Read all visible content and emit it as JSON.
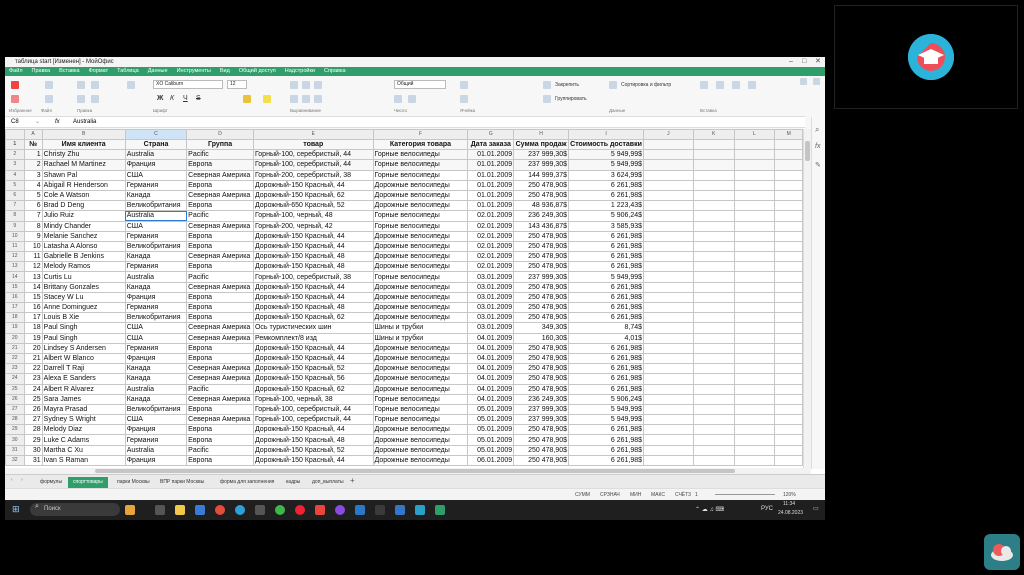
{
  "window": {
    "title": "таблица start [Изменен] - МойОфис"
  },
  "menu": [
    "Файл",
    "Правка",
    "Вставка",
    "Формат",
    "Таблица",
    "Данные",
    "Инструменты",
    "Вид",
    "Общий доступ",
    "Надстройки",
    "Справка"
  ],
  "ribbon": {
    "font": "XO Caliburn",
    "size": "12",
    "numformat": "Общий",
    "b": "Ж",
    "i": "К",
    "u": "Ч",
    "s": "S",
    "merge": "Закрепить",
    "group": "Группировать",
    "sort": "Сортировка и фильтр",
    "groups": {
      "favorites": "Избранное",
      "file": "Файл",
      "edit": "Правка",
      "font": "Шрифт",
      "align": "Выравнивание",
      "number": "Число",
      "cells": "Ячейка",
      "data": "Данные",
      "insert": "Вставка"
    }
  },
  "formula": {
    "cell": "C8",
    "fx": "fx",
    "value": "Australia"
  },
  "columns": [
    "",
    "A",
    "B",
    "C",
    "D",
    "E",
    "F",
    "G",
    "H",
    "I",
    "J",
    "K",
    "L",
    "M"
  ],
  "rows": [
    [
      "1",
      "№",
      "Имя клиента",
      "Страна",
      "Группа",
      "товар",
      "Категория товара",
      "Дата заказа",
      "Сумма продаж",
      "Стоимость доставки"
    ],
    [
      "2",
      "1",
      "Christy  Zhu",
      "Australia",
      "Pacific",
      "Горный-100, серебристый, 44",
      "Горные велосипеды",
      "01.01.2009",
      "237 999,30$",
      "5 949,99$"
    ],
    [
      "3",
      "2",
      "Rachael M Martinez",
      "Франция",
      "Европа",
      "Горный-100, серебристый, 44",
      "Горные велосипеды",
      "01.01.2009",
      "237 999,30$",
      "5 949,99$"
    ],
    [
      "4",
      "3",
      "Shawn  Pal",
      "США",
      "Северная Америка",
      "Горный-200, серебристый, 38",
      "Горные велосипеды",
      "01.01.2009",
      "144 999,37$",
      "3 624,99$"
    ],
    [
      "5",
      "4",
      "Abigail R Henderson",
      "Германия",
      "Европа",
      "Дорожный-150 Красный, 44",
      "Дорожные велосипеды",
      "01.01.2009",
      "250 478,90$",
      "6 261,98$"
    ],
    [
      "6",
      "5",
      "Cole A Watson",
      "Канада",
      "Северная Америка",
      "Дорожный-150 Красный, 62",
      "Дорожные велосипеды",
      "01.01.2009",
      "250 478,90$",
      "6 261,98$"
    ],
    [
      "7",
      "6",
      "Brad D Deng",
      "Великобритания",
      "Европа",
      "Дорожный-650 Красный, 52",
      "Дорожные велосипеды",
      "01.01.2009",
      "48 936,87$",
      "1 223,43$"
    ],
    [
      "8",
      "7",
      "Julio  Ruiz",
      "Australia",
      "Pacific",
      "Горный-100, черный, 48",
      "Горные велосипеды",
      "02.01.2009",
      "236 249,30$",
      "5 906,24$"
    ],
    [
      "9",
      "8",
      "Mindy  Chander",
      "США",
      "Северная Америка",
      "Горный-200, черный, 42",
      "Горные велосипеды",
      "02.01.2009",
      "143 436,87$",
      "3 585,93$"
    ],
    [
      "10",
      "9",
      "Melanie  Sanchez",
      "Германия",
      "Европа",
      "Дорожный-150 Красный, 44",
      "Дорожные велосипеды",
      "02.01.2009",
      "250 478,90$",
      "6 261,98$"
    ],
    [
      "11",
      "10",
      "Latasha A Alonso",
      "Великобритания",
      "Европа",
      "Дорожный-150 Красный, 44",
      "Дорожные велосипеды",
      "02.01.2009",
      "250 478,90$",
      "6 261,98$"
    ],
    [
      "12",
      "11",
      "Gabrielle B Jenkins",
      "Канада",
      "Северная Америка",
      "Дорожный-150 Красный, 48",
      "Дорожные велосипеды",
      "02.01.2009",
      "250 478,90$",
      "6 261,98$"
    ],
    [
      "13",
      "12",
      "Melody  Ramos",
      "Германия",
      "Европа",
      "Дорожный-150 Красный, 48",
      "Дорожные велосипеды",
      "02.01.2009",
      "250 478,90$",
      "6 261,98$"
    ],
    [
      "14",
      "13",
      "Curtis  Lu",
      "Australia",
      "Pacific",
      "Горный-100, серебристый, 38",
      "Горные велосипеды",
      "03.01.2009",
      "237 999,30$",
      "5 949,99$"
    ],
    [
      "15",
      "14",
      "Brittany  Gonzales",
      "Канада",
      "Северная Америка",
      "Дорожный-150 Красный, 44",
      "Дорожные велосипеды",
      "03.01.2009",
      "250 478,90$",
      "6 261,98$"
    ],
    [
      "16",
      "15",
      "Stacey W Lu",
      "Франция",
      "Европа",
      "Дорожный-150 Красный, 44",
      "Дорожные велосипеды",
      "03.01.2009",
      "250 478,90$",
      "6 261,98$"
    ],
    [
      "17",
      "16",
      "Anne  Dominguez",
      "Германия",
      "Европа",
      "Дорожный-150 Красный, 48",
      "Дорожные велосипеды",
      "03.01.2009",
      "250 478,90$",
      "6 261,98$"
    ],
    [
      "18",
      "17",
      "Louis B Xie",
      "Великобритания",
      "Европа",
      "Дорожный-150 Красный, 62",
      "Дорожные велосипеды",
      "03.01.2009",
      "250 478,90$",
      "6 261,98$"
    ],
    [
      "19",
      "18",
      "Paul  Singh",
      "США",
      "Северная Америка",
      "Ось туристических шин",
      "Шины и трубки",
      "03.01.2009",
      "349,30$",
      "8,74$"
    ],
    [
      "20",
      "19",
      "Paul  Singh",
      "США",
      "Северная Америка",
      "Ремкомплект/8 изд",
      "Шины и трубки",
      "04.01.2009",
      "160,30$",
      "4,01$"
    ],
    [
      "21",
      "20",
      "Lindsey S Andersen",
      "Германия",
      "Европа",
      "Дорожный-150 Красный, 44",
      "Дорожные велосипеды",
      "04.01.2009",
      "250 478,90$",
      "6 261,98$"
    ],
    [
      "22",
      "21",
      "Albert W Blanco",
      "Франция",
      "Европа",
      "Дорожный-150 Красный, 44",
      "Дорожные велосипеды",
      "04.01.2009",
      "250 478,90$",
      "6 261,98$"
    ],
    [
      "23",
      "22",
      "Darrell T Raji",
      "Канада",
      "Северная Америка",
      "Дорожный-150 Красный, 52",
      "Дорожные велосипеды",
      "04.01.2009",
      "250 478,90$",
      "6 261,98$"
    ],
    [
      "24",
      "23",
      "Alexa E Sanders",
      "Канада",
      "Северная Америка",
      "Дорожный-150 Красный, 56",
      "Дорожные велосипеды",
      "04.01.2009",
      "250 478,90$",
      "6 261,98$"
    ],
    [
      "25",
      "24",
      "Albert R Alvarez",
      "Australia",
      "Pacific",
      "Дорожный-150 Красный, 62",
      "Дорожные велосипеды",
      "04.01.2009",
      "250 478,90$",
      "6 261,98$"
    ],
    [
      "26",
      "25",
      "Sara  James",
      "Канада",
      "Северная Америка",
      "Горный-100, черный, 38",
      "Горные велосипеды",
      "04.01.2009",
      "236 249,30$",
      "5 906,24$"
    ],
    [
      "27",
      "26",
      "Mayra  Prasad",
      "Великобритания",
      "Европа",
      "Горный-100, серебристый, 44",
      "Горные велосипеды",
      "05.01.2009",
      "237 999,30$",
      "5 949,99$"
    ],
    [
      "28",
      "27",
      "Sydney S Wright",
      "США",
      "Северная Америка",
      "Горный-100, серебристый, 44",
      "Горные велосипеды",
      "05.01.2009",
      "237 999,30$",
      "5 949,99$"
    ],
    [
      "29",
      "28",
      "Melody  Diaz",
      "Франция",
      "Европа",
      "Дорожный-150 Красный, 44",
      "Дорожные велосипеды",
      "05.01.2009",
      "250 478,90$",
      "6 261,98$"
    ],
    [
      "30",
      "29",
      "Luke C Adams",
      "Германия",
      "Европа",
      "Дорожный-150 Красный, 48",
      "Дорожные велосипеды",
      "05.01.2009",
      "250 478,90$",
      "6 261,98$"
    ],
    [
      "31",
      "30",
      "Martha C Xu",
      "Australia",
      "Pacific",
      "Дорожный-150 Красный, 52",
      "Дорожные велосипеды",
      "05.01.2009",
      "250 478,90$",
      "6 261,98$"
    ],
    [
      "32",
      "31",
      "Ivan S Raman",
      "Франция",
      "Европа",
      "Дорожный-150 Красный, 44",
      "Дорожные велосипеды",
      "06.01.2009",
      "250 478,90$",
      "6 261,98$"
    ]
  ],
  "tabs": [
    "формулы",
    "спорттовары",
    "парки Москвы",
    "ВПР парки Москвы",
    "форма для заполнения",
    "кадры",
    "доп_выплаты"
  ],
  "active_tab": "спорттовары",
  "status": {
    "sum": "СУММ",
    "avg": "СРЗНАЧ",
    "min": "МИН",
    "max": "МАКС",
    "count": "СЧЁТ3",
    "count_val": "1",
    "zoom": "120%"
  },
  "taskbar": {
    "search": "Поиск",
    "lang": "РУС",
    "time": "11:34",
    "date": "24.08.2023"
  }
}
